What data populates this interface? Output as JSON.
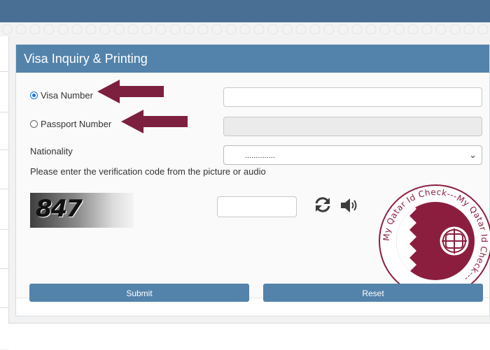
{
  "panel": {
    "title": "Visa Inquiry & Printing"
  },
  "form": {
    "visa_number_label": "Visa Number",
    "passport_number_label": "Passport Number",
    "nationality_label": "Nationality",
    "nationality_selected": "..............",
    "verification_prompt": "Please enter the verification code from the picture or audio",
    "selected_option": "Visa Number"
  },
  "captcha": {
    "text": "847"
  },
  "buttons": {
    "submit": "Submit",
    "reset": "Reset"
  },
  "icons": {
    "refresh": "refresh-icon",
    "audio": "speaker-icon",
    "arrow": "arrow-left-icon"
  },
  "watermark": {
    "text": "My Qatar Id Check---My Qatar Id Check---"
  },
  "colors": {
    "header": "#5383ab",
    "arrow": "#7d1f3e",
    "maroon": "#8b1e3f"
  }
}
